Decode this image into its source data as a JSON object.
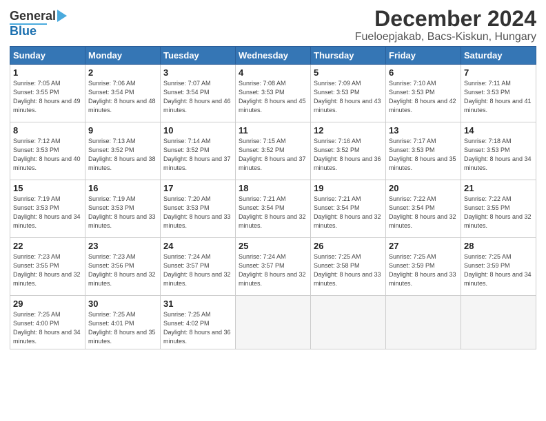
{
  "header": {
    "logo_line1": "General",
    "logo_line2": "Blue",
    "title": "December 2024",
    "subtitle": "Fueloepjakab, Bacs-Kiskun, Hungary"
  },
  "weekdays": [
    "Sunday",
    "Monday",
    "Tuesday",
    "Wednesday",
    "Thursday",
    "Friday",
    "Saturday"
  ],
  "weeks": [
    [
      {
        "day": "1",
        "sunrise": "7:05 AM",
        "sunset": "3:55 PM",
        "daylight": "8 hours and 49 minutes."
      },
      {
        "day": "2",
        "sunrise": "7:06 AM",
        "sunset": "3:54 PM",
        "daylight": "8 hours and 48 minutes."
      },
      {
        "day": "3",
        "sunrise": "7:07 AM",
        "sunset": "3:54 PM",
        "daylight": "8 hours and 46 minutes."
      },
      {
        "day": "4",
        "sunrise": "7:08 AM",
        "sunset": "3:53 PM",
        "daylight": "8 hours and 45 minutes."
      },
      {
        "day": "5",
        "sunrise": "7:09 AM",
        "sunset": "3:53 PM",
        "daylight": "8 hours and 43 minutes."
      },
      {
        "day": "6",
        "sunrise": "7:10 AM",
        "sunset": "3:53 PM",
        "daylight": "8 hours and 42 minutes."
      },
      {
        "day": "7",
        "sunrise": "7:11 AM",
        "sunset": "3:53 PM",
        "daylight": "8 hours and 41 minutes."
      }
    ],
    [
      {
        "day": "8",
        "sunrise": "7:12 AM",
        "sunset": "3:53 PM",
        "daylight": "8 hours and 40 minutes."
      },
      {
        "day": "9",
        "sunrise": "7:13 AM",
        "sunset": "3:52 PM",
        "daylight": "8 hours and 38 minutes."
      },
      {
        "day": "10",
        "sunrise": "7:14 AM",
        "sunset": "3:52 PM",
        "daylight": "8 hours and 37 minutes."
      },
      {
        "day": "11",
        "sunrise": "7:15 AM",
        "sunset": "3:52 PM",
        "daylight": "8 hours and 37 minutes."
      },
      {
        "day": "12",
        "sunrise": "7:16 AM",
        "sunset": "3:52 PM",
        "daylight": "8 hours and 36 minutes."
      },
      {
        "day": "13",
        "sunrise": "7:17 AM",
        "sunset": "3:53 PM",
        "daylight": "8 hours and 35 minutes."
      },
      {
        "day": "14",
        "sunrise": "7:18 AM",
        "sunset": "3:53 PM",
        "daylight": "8 hours and 34 minutes."
      }
    ],
    [
      {
        "day": "15",
        "sunrise": "7:19 AM",
        "sunset": "3:53 PM",
        "daylight": "8 hours and 34 minutes."
      },
      {
        "day": "16",
        "sunrise": "7:19 AM",
        "sunset": "3:53 PM",
        "daylight": "8 hours and 33 minutes."
      },
      {
        "day": "17",
        "sunrise": "7:20 AM",
        "sunset": "3:53 PM",
        "daylight": "8 hours and 33 minutes."
      },
      {
        "day": "18",
        "sunrise": "7:21 AM",
        "sunset": "3:54 PM",
        "daylight": "8 hours and 32 minutes."
      },
      {
        "day": "19",
        "sunrise": "7:21 AM",
        "sunset": "3:54 PM",
        "daylight": "8 hours and 32 minutes."
      },
      {
        "day": "20",
        "sunrise": "7:22 AM",
        "sunset": "3:54 PM",
        "daylight": "8 hours and 32 minutes."
      },
      {
        "day": "21",
        "sunrise": "7:22 AM",
        "sunset": "3:55 PM",
        "daylight": "8 hours and 32 minutes."
      }
    ],
    [
      {
        "day": "22",
        "sunrise": "7:23 AM",
        "sunset": "3:55 PM",
        "daylight": "8 hours and 32 minutes."
      },
      {
        "day": "23",
        "sunrise": "7:23 AM",
        "sunset": "3:56 PM",
        "daylight": "8 hours and 32 minutes."
      },
      {
        "day": "24",
        "sunrise": "7:24 AM",
        "sunset": "3:57 PM",
        "daylight": "8 hours and 32 minutes."
      },
      {
        "day": "25",
        "sunrise": "7:24 AM",
        "sunset": "3:57 PM",
        "daylight": "8 hours and 32 minutes."
      },
      {
        "day": "26",
        "sunrise": "7:25 AM",
        "sunset": "3:58 PM",
        "daylight": "8 hours and 33 minutes."
      },
      {
        "day": "27",
        "sunrise": "7:25 AM",
        "sunset": "3:59 PM",
        "daylight": "8 hours and 33 minutes."
      },
      {
        "day": "28",
        "sunrise": "7:25 AM",
        "sunset": "3:59 PM",
        "daylight": "8 hours and 34 minutes."
      }
    ],
    [
      {
        "day": "29",
        "sunrise": "7:25 AM",
        "sunset": "4:00 PM",
        "daylight": "8 hours and 34 minutes."
      },
      {
        "day": "30",
        "sunrise": "7:25 AM",
        "sunset": "4:01 PM",
        "daylight": "8 hours and 35 minutes."
      },
      {
        "day": "31",
        "sunrise": "7:25 AM",
        "sunset": "4:02 PM",
        "daylight": "8 hours and 36 minutes."
      },
      null,
      null,
      null,
      null
    ]
  ]
}
